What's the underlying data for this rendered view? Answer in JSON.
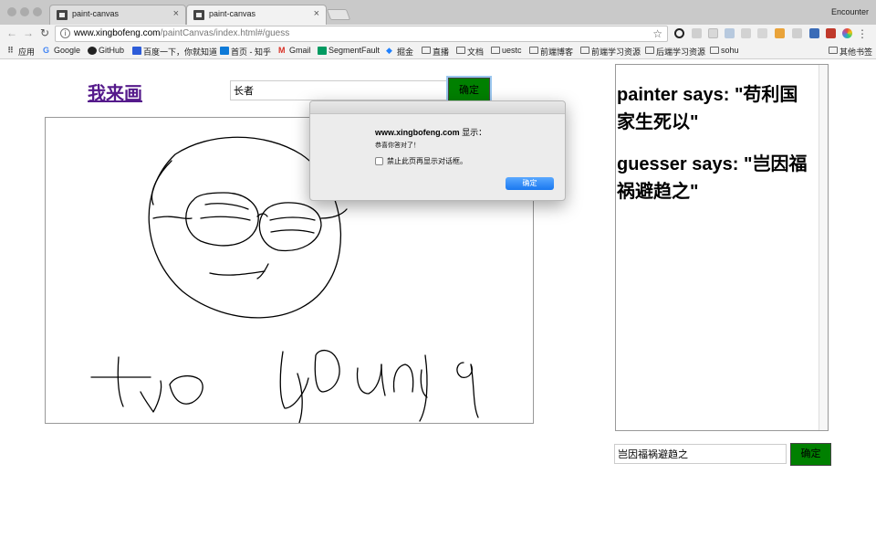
{
  "browser": {
    "tabs": [
      {
        "title": "paint-canvas",
        "active": false
      },
      {
        "title": "paint-canvas",
        "active": true
      }
    ],
    "profile_name": "Encounter",
    "url_host": "www.xingbofeng.com",
    "url_path": "/paintCanvas/index.html#/guess",
    "bookmarks": [
      {
        "label": "应用",
        "icon": "apps-grid-icon"
      },
      {
        "label": "Google",
        "icon": "google-icon"
      },
      {
        "label": "GitHub",
        "icon": "github-icon"
      },
      {
        "label": "百度一下，你就知道",
        "icon": "baidu-icon"
      },
      {
        "label": "首页 - 知乎",
        "icon": "zhihu-icon"
      },
      {
        "label": "Gmail",
        "icon": "gmail-icon"
      },
      {
        "label": "SegmentFault",
        "icon": "segmentfault-icon"
      },
      {
        "label": "掘金",
        "icon": "juejin-icon"
      },
      {
        "label": "直播",
        "icon": "folder-icon"
      },
      {
        "label": "文档",
        "icon": "folder-icon"
      },
      {
        "label": "uestc",
        "icon": "folder-icon"
      },
      {
        "label": "前端博客",
        "icon": "folder-icon"
      },
      {
        "label": "前端学习资源",
        "icon": "folder-icon"
      },
      {
        "label": "后端学习资源",
        "icon": "folder-icon"
      },
      {
        "label": "sohu",
        "icon": "folder-icon"
      },
      {
        "label": "其他书签",
        "icon": "folder-icon"
      }
    ]
  },
  "game": {
    "title": "我来画",
    "word_input_value": "长者",
    "word_confirm_label": "确定",
    "guess_input_value": "岂因福祸避趋之",
    "guess_confirm_label": "确定",
    "button_color": "#008000",
    "link_color": "#551a8b",
    "messages": [
      {
        "text": "painter says: \"苟利国家生死以\""
      },
      {
        "text": "guesser says: \"岂因福祸避趋之\""
      }
    ]
  },
  "dialog": {
    "site": "www.xingbofeng.com",
    "suffix": " 显示：",
    "message": "恭喜你答对了！",
    "checkbox_label": "禁止此页再显示对话框。",
    "ok_label": "确定"
  }
}
